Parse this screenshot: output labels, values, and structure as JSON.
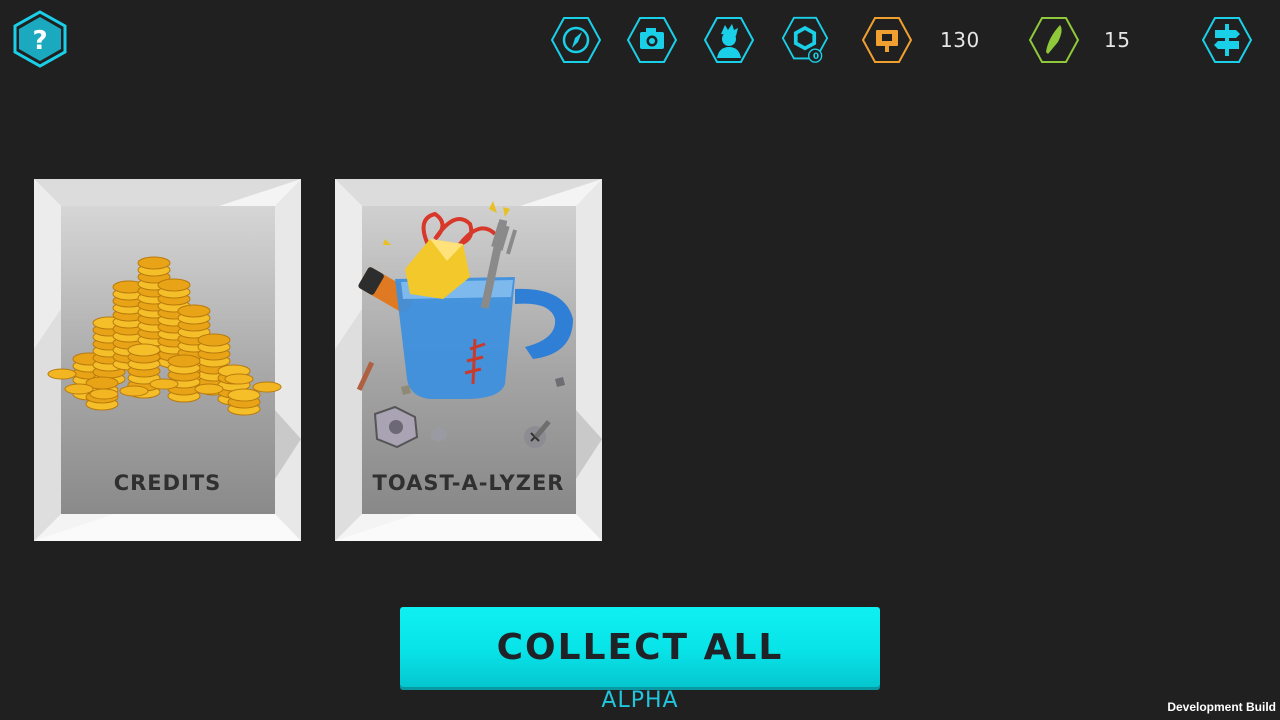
{
  "colors": {
    "background": "#212021",
    "hud_cyan": "#1ad0e8",
    "credits_orange": "#f0a030",
    "gems_green": "#8fc83a",
    "button_cyan": "#08e3e8",
    "card_label": "#303030"
  },
  "header": {
    "help": {
      "icon": "question-mark-icon"
    },
    "nav_icons": [
      {
        "name": "compass-icon"
      },
      {
        "name": "camera-icon"
      },
      {
        "name": "avatar-icon"
      },
      {
        "name": "parts-icon",
        "badge": "0"
      }
    ],
    "currencies": [
      {
        "icon": "credits-icon",
        "value": "130"
      },
      {
        "icon": "crystal-icon",
        "value": "15"
      }
    ],
    "signpost": {
      "icon": "signpost-icon"
    }
  },
  "rewards": [
    {
      "label": "CREDITS",
      "art": "coin-stacks"
    },
    {
      "label": "TOAST-A-LYZER",
      "art": "toast-a-lyzer-mug"
    }
  ],
  "actions": {
    "collect_all": "COLLECT ALL"
  },
  "footer": {
    "build_channel": "ALPHA",
    "dev_build": "Development Build"
  }
}
